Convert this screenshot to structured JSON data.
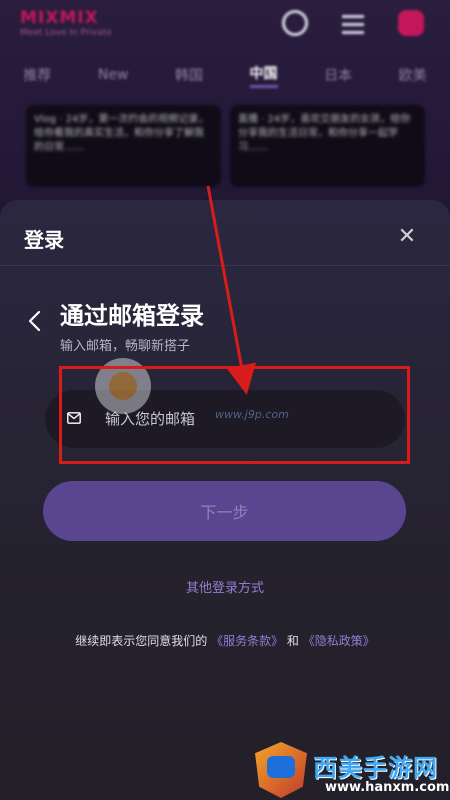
{
  "background_app": {
    "logo": "MIXMIX",
    "slogan": "Meet Love In Private",
    "tabs": [
      "推荐",
      "New",
      "韩国",
      "中国",
      "日本",
      "欧美"
    ],
    "active_tab_index": 3,
    "cards": [
      {
        "text": "Vlog · 24岁，第一次约会的视频记录，给你看我的真实生活，和你分享了解我的日常……"
      },
      {
        "text": "直播 · 24岁，喜欢交朋友的女孩，给你分享我的生活日常，和你分享一起学习……"
      }
    ]
  },
  "modal": {
    "title": "登录",
    "close_icon": "close-icon",
    "heading": "通过邮箱登录",
    "subheading": "输入邮箱，畅聊新搭子",
    "email": {
      "placeholder": "输入您的邮箱",
      "value": "",
      "icon": "mail-icon"
    },
    "next_label": "下一步",
    "other_login_label": "其他登录方式",
    "terms": {
      "prefix": "继续即表示您同意我们的",
      "service_link": "《服务条款》",
      "conjunction": "和",
      "privacy_link": "《隐私政策》"
    }
  },
  "colors": {
    "accent": "#5a4690",
    "link": "#8f7fd0",
    "annotation": "#d81b1b",
    "brand_logo": "#c2185b"
  },
  "watermarks": {
    "center_url": "www.j9p.com",
    "bottom_brand": "西美手游网",
    "bottom_site": "www.hanxm.com"
  }
}
